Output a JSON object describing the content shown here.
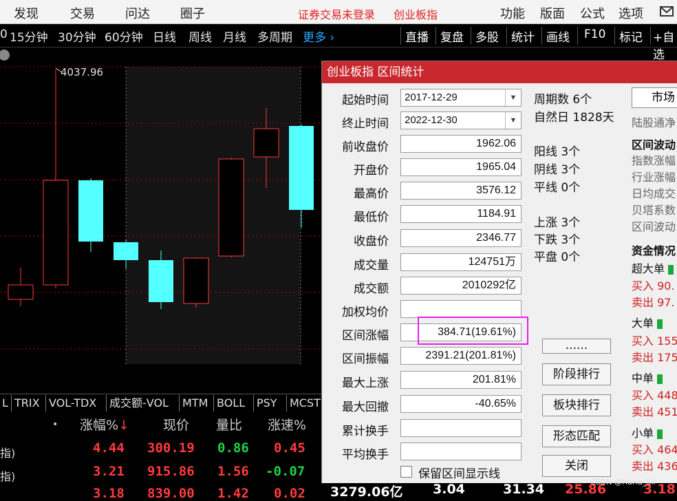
{
  "menu": {
    "items": [
      "发现",
      "交易",
      "问达",
      "圈子"
    ],
    "status_text": "证券交易未登录",
    "index_name": "创业板指",
    "right_items": [
      "功能",
      "版面",
      "公式",
      "选项"
    ],
    "mail_icon": "mail-icon"
  },
  "toolbar": {
    "periods": [
      "0",
      "15分钟",
      "30分钟",
      "60分钟",
      "日线",
      "周线",
      "月线",
      "多周期"
    ],
    "more": "更多",
    "right_buttons": [
      "直播",
      "复盘",
      "多股",
      "统计",
      "画线",
      "F10",
      "标记",
      "+自选"
    ]
  },
  "chart": {
    "high_label": "4037.96",
    "colors": {
      "up": "#ff3b3b",
      "down": "#54ffff",
      "grid": "#8b0000"
    }
  },
  "indicators": {
    "tabs": [
      "L",
      "TRIX",
      "VOL-TDX",
      "成交额-VOL",
      "MTM",
      "BOLL",
      "PSY",
      "MCST"
    ]
  },
  "table": {
    "headers": [
      "•",
      "涨幅%",
      "现价",
      "量比",
      "涨速%"
    ],
    "rows": [
      {
        "name": "指)",
        "change": "4.44",
        "price": "300.19",
        "ratio": "0.86",
        "speed": "0.45"
      },
      {
        "name": "指)",
        "change": "3.21",
        "price": "915.86",
        "ratio": "1.56",
        "speed": "-0.07"
      },
      {
        "name": "",
        "change": "3.18",
        "price": "839.00",
        "ratio": "1.42",
        "speed": "0.02"
      }
    ]
  },
  "dialog": {
    "title": "创业板指 区间统计",
    "labels": {
      "start": "起始时间",
      "end": "终止时间",
      "prev_close": "前收盘价",
      "open": "开盘价",
      "high": "最高价",
      "low": "最低价",
      "close": "收盘价",
      "volume": "成交量",
      "amount": "成交额",
      "wavg": "加权均价",
      "range_change": "区间涨幅",
      "range_amp": "区间振幅",
      "max_up": "最大上涨",
      "max_dd": "最大回撤",
      "cum_turnover": "累计换手",
      "avg_turnover": "平均换手"
    },
    "values": {
      "start": "2017-12-29",
      "end": "2022-12-30",
      "prev_close": "1962.06",
      "open": "1965.04",
      "high": "3576.12",
      "low": "1184.91",
      "close": "2346.77",
      "volume": "124751万",
      "amount": "2010292亿",
      "wavg": "",
      "range_change": "384.71(19.61%)",
      "range_amp": "2391.21(201.81%)",
      "max_up": "201.81%",
      "max_dd": "-40.65%",
      "cum_turnover": "",
      "avg_turnover": ""
    },
    "stats": {
      "periods": "周期数 6个",
      "natural_days": "自然日 1828天",
      "yang": "阳线 3个",
      "yin": "阴线 3个",
      "flat_line": "平线 0个",
      "up": "上涨 3个",
      "down": "下跌 3个",
      "flat": "平盘 0个"
    },
    "buttons": {
      "more": "......",
      "stage_rank": "阶段排行",
      "sector_rank": "板块排行",
      "pattern": "形态匹配",
      "close": "关闭"
    },
    "checkbox_label": "保留区间显示线",
    "side": {
      "market_button": "市场",
      "hk_flow": "陆股通净",
      "wave_title": "区间波动",
      "wave_items": [
        "指数涨幅",
        "行业涨幅",
        "日均成交",
        "贝塔系数",
        "区间波动"
      ],
      "fund_title": "资金情况",
      "super": {
        "label": "超大单",
        "buy": "买入 90.",
        "sell": "卖出 97."
      },
      "big": {
        "label": "大单",
        "buy": "买入 155",
        "sell": "卖出 175"
      },
      "mid": {
        "label": "中单",
        "buy": "买入 448",
        "sell": "卖出 451"
      },
      "small": {
        "label": "小单",
        "buy": "买入 464",
        "sell": "卖出 436"
      }
    }
  },
  "bottom_strip": [
    "3279.06亿",
    "3.04",
    "31.34",
    "25.86",
    "3.18"
  ],
  "watermark": "CSDN @HaHa_Sir"
}
